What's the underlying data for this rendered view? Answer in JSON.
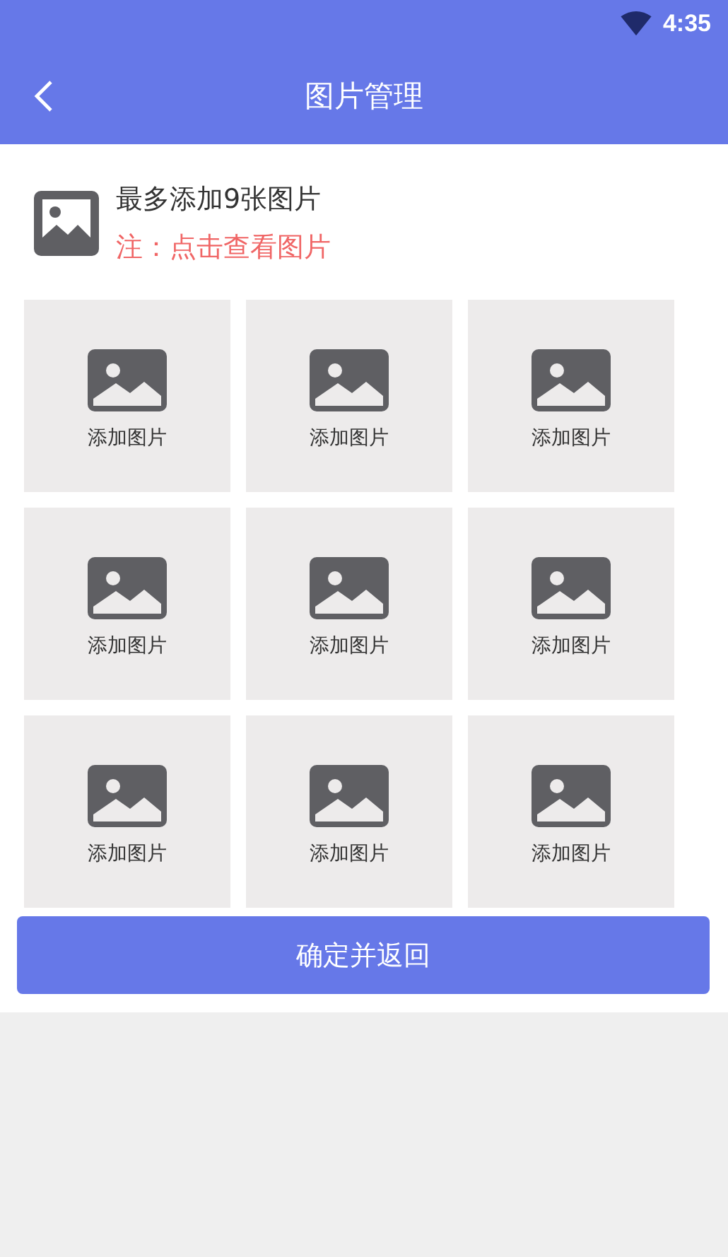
{
  "status_bar": {
    "time": "4:35"
  },
  "header": {
    "title": "图片管理"
  },
  "info": {
    "title": "最多添加9张图片",
    "note": "注：点击查看图片"
  },
  "slots": [
    {
      "label": "添加图片"
    },
    {
      "label": "添加图片"
    },
    {
      "label": "添加图片"
    },
    {
      "label": "添加图片"
    },
    {
      "label": "添加图片"
    },
    {
      "label": "添加图片"
    },
    {
      "label": "添加图片"
    },
    {
      "label": "添加图片"
    },
    {
      "label": "添加图片"
    }
  ],
  "confirm_button": "确定并返回"
}
